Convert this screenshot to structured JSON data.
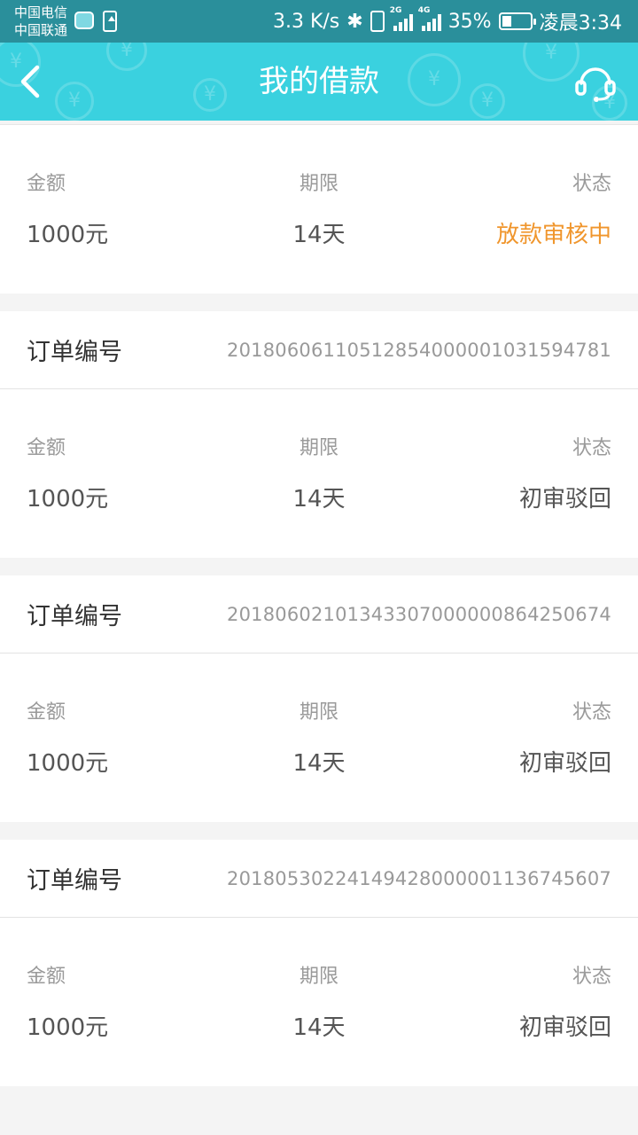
{
  "status_bar": {
    "carrier1": "中国电信",
    "carrier2": "中国联通",
    "speed": "3.3 K/s",
    "net1": "2G",
    "net2": "4G",
    "battery": "35%",
    "battery_level": 0.35,
    "time": "凌晨3:34",
    "icons": [
      "app-icon",
      "upload-icon",
      "bluetooth-icon",
      "vibrate-icon",
      "signal-icon",
      "battery-icon"
    ]
  },
  "header": {
    "title": "我的借款",
    "back_icon": "chevron-left-icon",
    "support_icon": "headset-icon",
    "color": "#3ad1df"
  },
  "labels": {
    "order_no": "订单编号",
    "amount": "金额",
    "term": "期限",
    "status": "状态"
  },
  "loans": [
    {
      "order_no": "",
      "amount": "1000元",
      "term": "14天",
      "status": "放款审核中",
      "status_color": "#f0962d"
    },
    {
      "order_no": "201806061105128540000010315947​81",
      "amount": "1000元",
      "term": "14天",
      "status": "初审驳回"
    },
    {
      "order_no": "20180602101343307000000864250674",
      "amount": "1000元",
      "term": "14天",
      "status": "初审驳回"
    },
    {
      "order_no": "20180530224149428000001136745607",
      "amount": "1000元",
      "term": "14天",
      "status": "初审驳回"
    }
  ]
}
